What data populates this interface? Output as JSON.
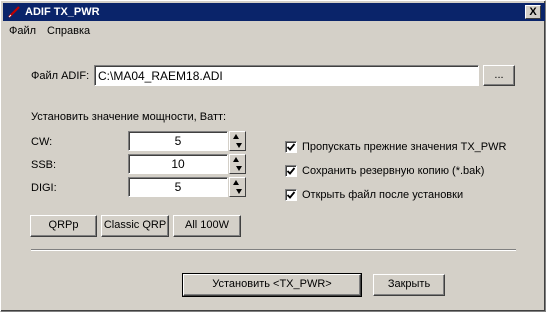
{
  "window": {
    "title": "ADIF TX_PWR",
    "close_label": "X"
  },
  "menu": {
    "items": [
      "Файл",
      "Справка"
    ]
  },
  "file": {
    "label": "Файл ADIF:",
    "value": "C:\\MA04_RAEM18.ADI",
    "browse_label": "..."
  },
  "power": {
    "section_label": "Установить значение мощности, Ватт:",
    "modes": [
      {
        "label": "CW:",
        "value": "5"
      },
      {
        "label": "SSB:",
        "value": "10"
      },
      {
        "label": "DIGI:",
        "value": "5"
      }
    ]
  },
  "options": [
    {
      "label": "Пропускать прежние значения TX_PWR",
      "checked": true
    },
    {
      "label": "Сохранить резервную копию (*.bak)",
      "checked": true
    },
    {
      "label": "Открыть файл после установки",
      "checked": true
    }
  ],
  "presets": [
    "QRPp",
    "Classic QRP",
    "All 100W"
  ],
  "actions": {
    "apply_label": "Установить <TX_PWR>",
    "close_label": "Закрыть"
  }
}
